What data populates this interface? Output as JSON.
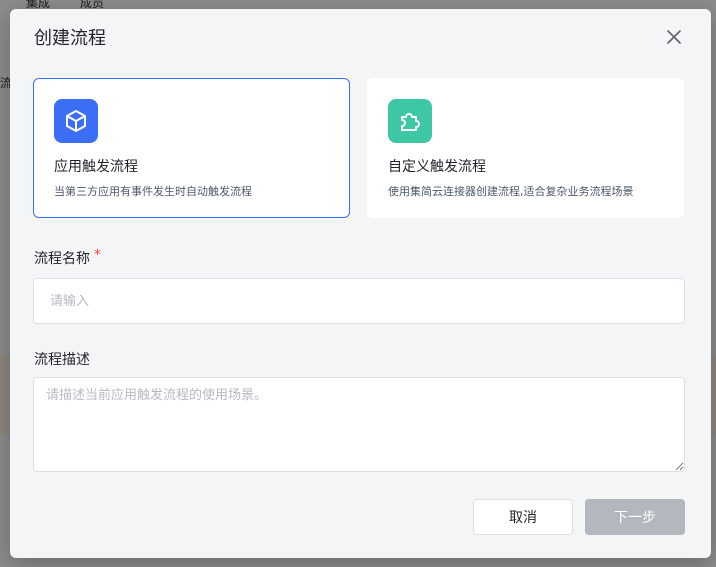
{
  "background": {
    "nav_items": [
      "集成",
      "成员"
    ],
    "side_text": "流"
  },
  "modal": {
    "title": "创建流程",
    "cards": [
      {
        "title": "应用触发流程",
        "desc": "当第三方应用有事件发生时自动触发流程",
        "icon": "cube-icon",
        "icon_color": "#3b6ef5",
        "selected": true
      },
      {
        "title": "自定义触发流程",
        "desc": "使用集简云连接器创建流程,适合复杂业务流程场景",
        "icon": "puzzle-icon",
        "icon_color": "#3ec7a4",
        "selected": false
      }
    ],
    "fields": {
      "name_label": "流程名称",
      "name_required": "*",
      "name_placeholder": "请输入",
      "name_value": "",
      "desc_label": "流程描述",
      "desc_placeholder": "请描述当前应用触发流程的使用场景。",
      "desc_value": ""
    },
    "buttons": {
      "cancel": "取消",
      "next": "下一步"
    },
    "colors": {
      "accent": "#3370ff",
      "disabled_button": "#b3b7be",
      "required": "#f54a45"
    }
  }
}
